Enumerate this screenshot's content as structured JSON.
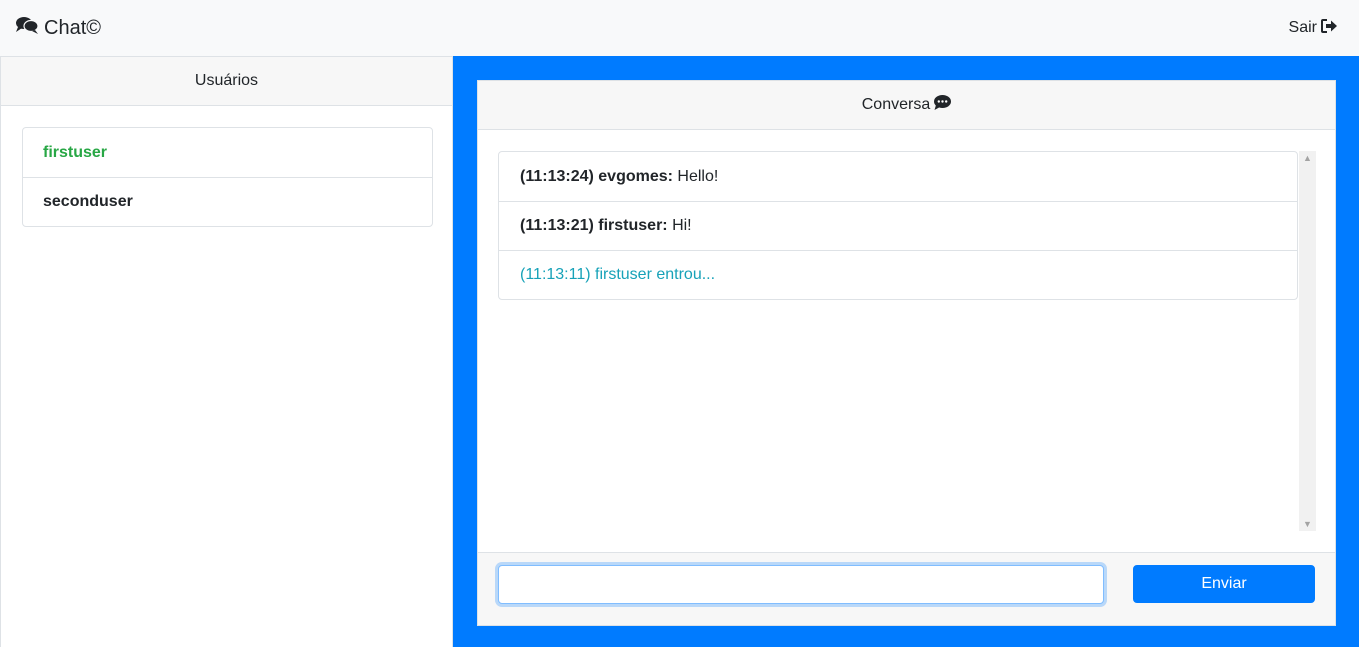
{
  "navbar": {
    "brand_label": "Chat©",
    "brand_icon": "comments-icon",
    "logout_label": "Sair",
    "logout_icon": "sign-out-icon"
  },
  "sidebar": {
    "title": "Usuários",
    "users": [
      {
        "name": "firstuser",
        "status": "online",
        "color": "#28a745"
      },
      {
        "name": "seconduser",
        "status": "offline",
        "color": "#212529"
      }
    ]
  },
  "chat": {
    "title": "Conversa",
    "title_icon": "comment-dots-icon",
    "messages": [
      {
        "meta": "(11:13:24) evgomes:",
        "text": " Hello!"
      },
      {
        "meta": "(11:13:21) firstuser:",
        "text": " Hi!"
      },
      {
        "system": "(11:13:11) firstuser entrou..."
      }
    ],
    "input": {
      "value": "",
      "placeholder": ""
    },
    "send_label": "Enviar"
  },
  "colors": {
    "primary": "#007bff",
    "online": "#28a745",
    "system_message": "#17a2b8",
    "panel_header": "#f7f7f7",
    "navbar": "#f8f9fa"
  }
}
